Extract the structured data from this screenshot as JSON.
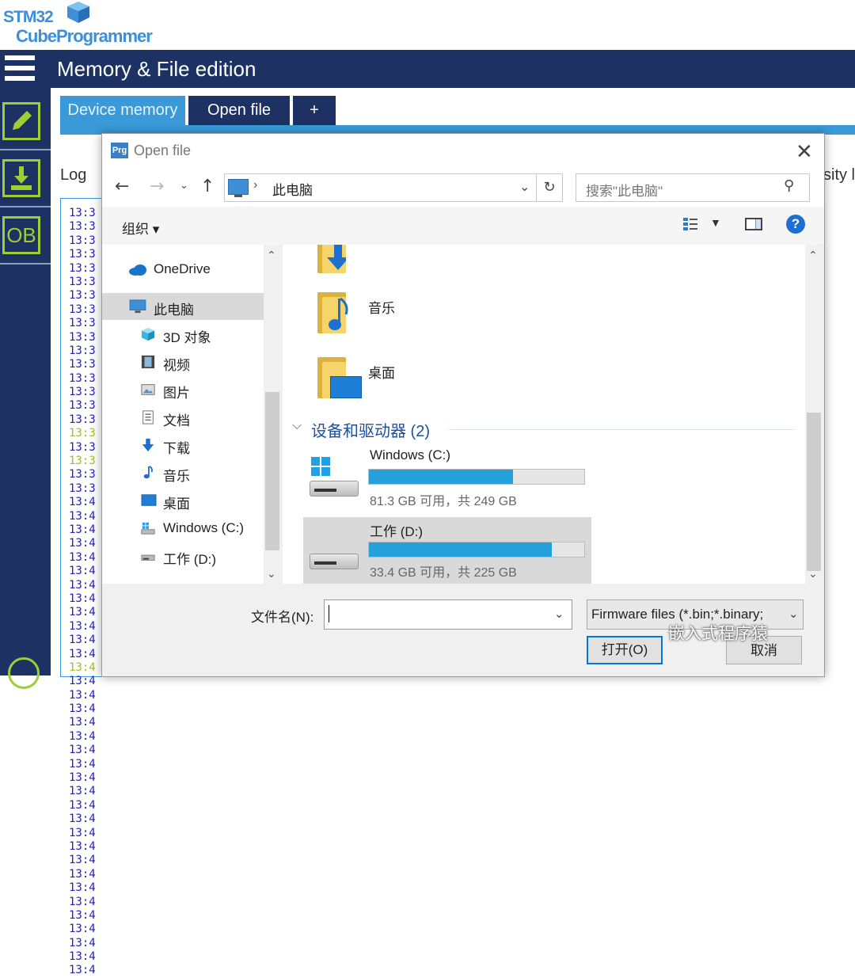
{
  "app": {
    "logo_line1": "STM32",
    "logo_line2": "CubeProgrammer",
    "page_title": "Memory & File edition",
    "sidebar": [
      {
        "name": "memory-edit",
        "label": ""
      },
      {
        "name": "download",
        "label": ""
      },
      {
        "name": "option-bytes",
        "label": "OB"
      }
    ],
    "tabs": [
      {
        "label": "Device memory",
        "active": true
      },
      {
        "label": "Open file",
        "active": false
      },
      {
        "label": "+",
        "active": false
      }
    ],
    "log_label": "Log",
    "right_label_partial": "sity l",
    "log_times": [
      "13:3",
      "13:3",
      "13:3",
      "13:3",
      "13:3",
      "13:3",
      "13:3",
      "13:3",
      "13:3",
      "13:3",
      "13:3",
      "13:3",
      "13:3",
      "13:3",
      "13:3",
      "13:3",
      "13:3",
      "13:3",
      "13:3",
      "13:3",
      "13:3",
      "13:4",
      "13:4",
      "13:4",
      "13:4",
      "13:4",
      "13:4",
      "13:4",
      "13:4",
      "13:4",
      "13:4",
      "13:4",
      "13:4",
      "13:4",
      "13:4",
      "13:4",
      "13:4",
      "13:4",
      "13:4",
      "13:4",
      "13:4",
      "13:4",
      "13:4",
      "13:4",
      "13:4",
      "13:4",
      "13:4",
      "13:4",
      "13:4",
      "13:4",
      "13:4",
      "13:4",
      "13:4",
      "13:4",
      "13:4",
      "13:4"
    ],
    "log_highlight_indexes": [
      16,
      18,
      33
    ]
  },
  "dialog": {
    "title": "Open file",
    "icon_text": "Prg",
    "address": "此电脑",
    "search_placeholder": "搜索\"此电脑\"",
    "organize": "组织 ▾",
    "nav_items": [
      {
        "label": "OneDrive",
        "icon": "onedrive-icon",
        "selected": false
      },
      {
        "label": "此电脑",
        "icon": "computer-icon",
        "selected": true
      },
      {
        "label": "3D 对象",
        "icon": "3d-objects-icon",
        "selected": false
      },
      {
        "label": "视频",
        "icon": "video-icon",
        "selected": false
      },
      {
        "label": "图片",
        "icon": "pictures-icon",
        "selected": false
      },
      {
        "label": "文档",
        "icon": "documents-icon",
        "selected": false
      },
      {
        "label": "下载",
        "icon": "download-icon",
        "selected": false
      },
      {
        "label": "音乐",
        "icon": "music-icon",
        "selected": false
      },
      {
        "label": "桌面",
        "icon": "desktop-icon",
        "selected": false
      },
      {
        "label": "Windows (C:)",
        "icon": "drive-c-icon",
        "selected": false
      },
      {
        "label": "工作 (D:)",
        "icon": "drive-d-icon",
        "selected": false
      }
    ],
    "folders": [
      {
        "label": "",
        "icon": "download-folder-icon"
      },
      {
        "label": "音乐",
        "icon": "music-folder-icon"
      },
      {
        "label": "桌面",
        "icon": "desktop-folder-icon"
      }
    ],
    "group_header": "设备和驱动器 (2)",
    "drives": [
      {
        "name": "Windows (C:)",
        "free": "81.3 GB 可用，共 249 GB",
        "used_fraction": 0.67,
        "selected": false
      },
      {
        "name": "工作 (D:)",
        "free": "33.4 GB 可用，共 225 GB",
        "used_fraction": 0.85,
        "selected": true
      }
    ],
    "filename_label": "文件名(N):",
    "filename_value": "",
    "filetype": "Firmware files (*.bin;*.binary;",
    "open_button": "打开(O)",
    "cancel_button": "取消"
  },
  "watermark": "嵌入式程序猿",
  "colors": {
    "sidebar_bg": "#1d3263",
    "tab_active": "#3a9ad9",
    "accent_green": "#9ecd34",
    "drive_bar": "#26a0da",
    "log_text": "#2020c8",
    "log_highlight": "#9bc21f"
  }
}
